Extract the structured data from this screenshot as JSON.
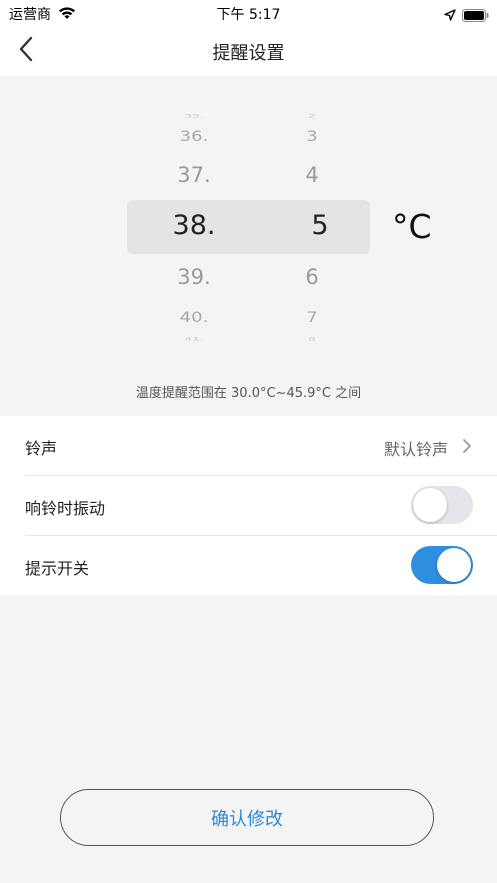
{
  "status_bar": {
    "carrier": "运营商",
    "time": "下午 5:17",
    "icons": [
      "wifi-icon",
      "location-icon",
      "battery-icon"
    ]
  },
  "nav": {
    "title": "提醒设置",
    "back_icon": "chevron-left-icon"
  },
  "picker": {
    "integer_column": [
      "35.",
      "36.",
      "37.",
      "38.",
      "39.",
      "40.",
      "41."
    ],
    "decimal_column": [
      "2",
      "3",
      "4",
      "5",
      "6",
      "7",
      "8"
    ],
    "selected_integer": "38.",
    "selected_decimal": "5",
    "unit": "°C",
    "range_note": "温度提醒范围在 30.0°C~45.9°C 之间"
  },
  "settings": {
    "ringtone": {
      "label": "铃声",
      "value": "默认铃声"
    },
    "vibrate": {
      "label": "响铃时振动",
      "enabled": false
    },
    "reminder": {
      "label": "提示开关",
      "enabled": true
    }
  },
  "confirm_label": "确认修改",
  "colors": {
    "accent": "#2e8fe0",
    "confirm_text": "#2b8ad8",
    "background": "#f4f4f4"
  }
}
